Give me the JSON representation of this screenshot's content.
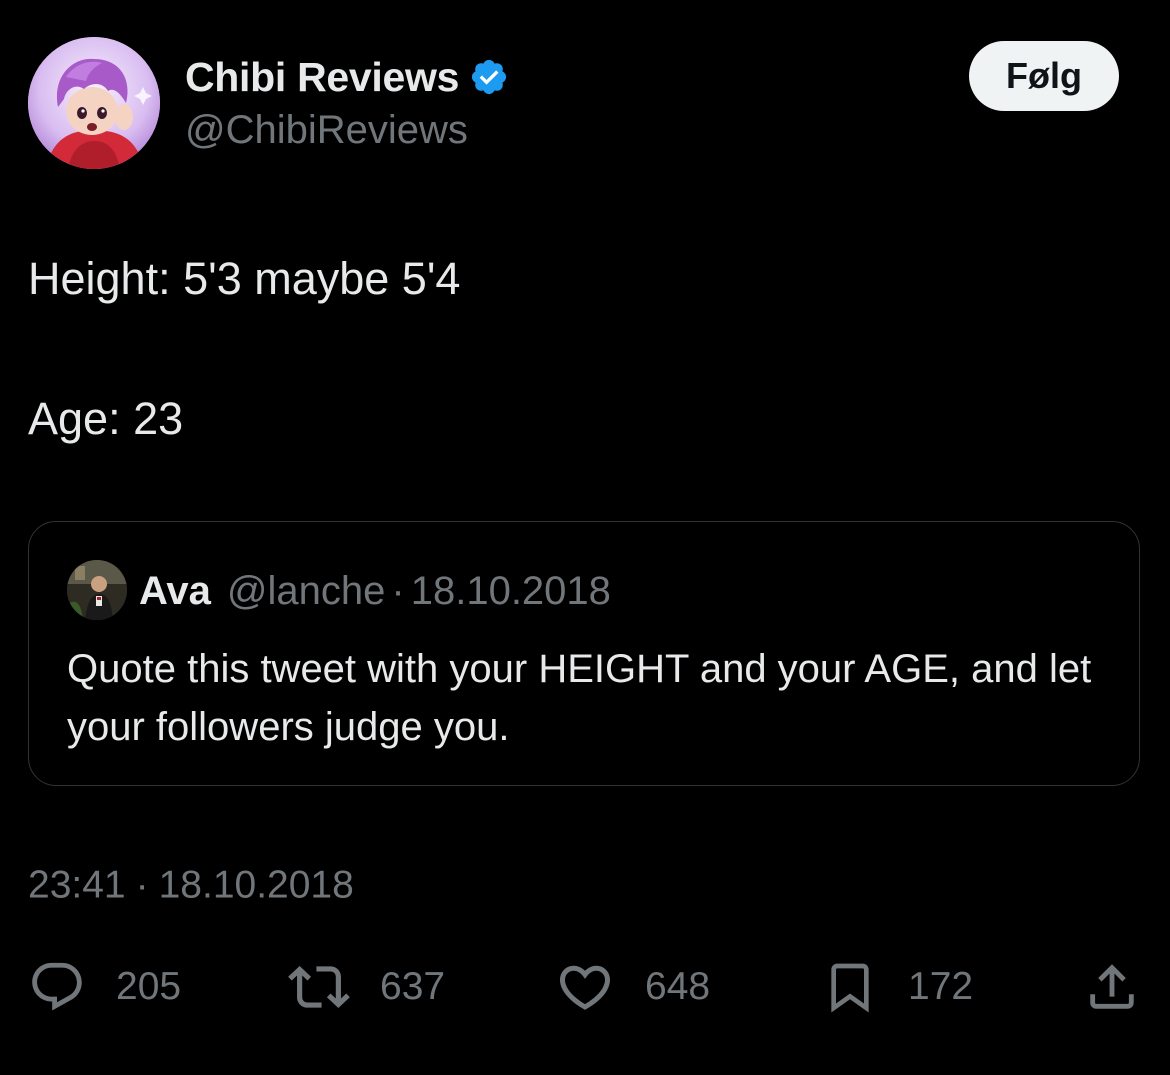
{
  "author": {
    "display_name": "Chibi Reviews",
    "handle": "@ChibiReviews",
    "verified": true,
    "avatar_icon": "chibi-character-avatar"
  },
  "follow_button": {
    "label": "Følg"
  },
  "tweet": {
    "lines": [
      "Height: 5'3 maybe 5'4",
      "Age: 23"
    ]
  },
  "quoted_tweet": {
    "display_name": "Ava",
    "handle": "@lanche",
    "separator": "·",
    "date": "18.10.2018",
    "text": "Quote this tweet with your HEIGHT and your AGE, and let your followers judge you."
  },
  "timestamp": {
    "time": "23:41",
    "separator": "·",
    "date": "18.10.2018"
  },
  "actions": {
    "replies": "205",
    "retweets": "637",
    "likes": "648",
    "bookmarks": "172"
  },
  "colors": {
    "background": "#000000",
    "primary_text": "#e7e9ea",
    "secondary_text": "#71767b",
    "verified_blue": "#1d9bf0",
    "border": "#2f3336",
    "follow_bg": "#eff3f4"
  }
}
